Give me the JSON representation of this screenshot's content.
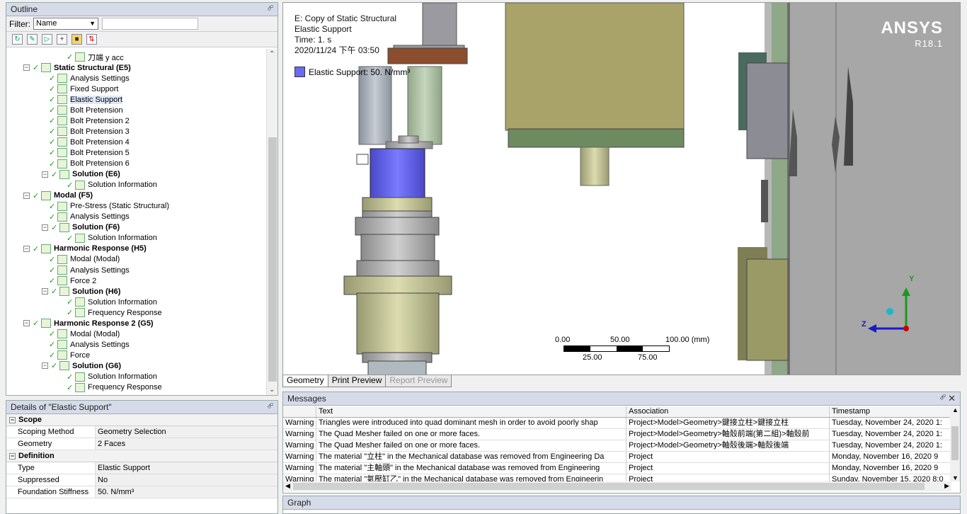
{
  "outline": {
    "title": "Outline",
    "pin": "⬇",
    "filter_label": "Filter:",
    "filter_value": "Name",
    "tree": [
      {
        "label": "刀端 y acc",
        "level": 4,
        "bold": false
      },
      {
        "label": "Static Structural (E5)",
        "level": 2,
        "bold": true,
        "expand": "−"
      },
      {
        "label": "Analysis Settings",
        "level": 3,
        "bold": false
      },
      {
        "label": "Fixed Support",
        "level": 3,
        "bold": false
      },
      {
        "label": "Elastic Support",
        "level": 3,
        "bold": false,
        "selected": true
      },
      {
        "label": "Bolt Pretension",
        "level": 3,
        "bold": false
      },
      {
        "label": "Bolt Pretension 2",
        "level": 3,
        "bold": false
      },
      {
        "label": "Bolt Pretension 3",
        "level": 3,
        "bold": false
      },
      {
        "label": "Bolt Pretension 4",
        "level": 3,
        "bold": false
      },
      {
        "label": "Bolt Pretension 5",
        "level": 3,
        "bold": false
      },
      {
        "label": "Bolt Pretension 6",
        "level": 3,
        "bold": false
      },
      {
        "label": "Solution (E6)",
        "level": 3,
        "bold": true,
        "expand": "−"
      },
      {
        "label": "Solution Information",
        "level": 4,
        "bold": false
      },
      {
        "label": "Modal (F5)",
        "level": 2,
        "bold": true,
        "expand": "−"
      },
      {
        "label": "Pre-Stress (Static Structural)",
        "level": 3,
        "bold": false
      },
      {
        "label": "Analysis Settings",
        "level": 3,
        "bold": false
      },
      {
        "label": "Solution (F6)",
        "level": 3,
        "bold": true,
        "expand": "−"
      },
      {
        "label": "Solution Information",
        "level": 4,
        "bold": false
      },
      {
        "label": "Harmonic Response (H5)",
        "level": 2,
        "bold": true,
        "expand": "−"
      },
      {
        "label": "Modal (Modal)",
        "level": 3,
        "bold": false
      },
      {
        "label": "Analysis Settings",
        "level": 3,
        "bold": false
      },
      {
        "label": "Force 2",
        "level": 3,
        "bold": false
      },
      {
        "label": "Solution (H6)",
        "level": 3,
        "bold": true,
        "expand": "−"
      },
      {
        "label": "Solution Information",
        "level": 4,
        "bold": false
      },
      {
        "label": "Frequency Response",
        "level": 4,
        "bold": false
      },
      {
        "label": "Harmonic Response 2 (G5)",
        "level": 2,
        "bold": true,
        "expand": "−"
      },
      {
        "label": "Modal (Modal)",
        "level": 3,
        "bold": false
      },
      {
        "label": "Analysis Settings",
        "level": 3,
        "bold": false
      },
      {
        "label": "Force",
        "level": 3,
        "bold": false
      },
      {
        "label": "Solution (G6)",
        "level": 3,
        "bold": true,
        "expand": "−"
      },
      {
        "label": "Solution Information",
        "level": 4,
        "bold": false
      },
      {
        "label": "Frequency Response",
        "level": 4,
        "bold": false
      }
    ]
  },
  "details": {
    "title": "Details of \"Elastic Support\"",
    "groups": [
      {
        "name": "Scope",
        "rows": [
          [
            "Scoping Method",
            "Geometry Selection"
          ],
          [
            "Geometry",
            "2 Faces"
          ]
        ]
      },
      {
        "name": "Definition",
        "rows": [
          [
            "Type",
            "Elastic Support"
          ],
          [
            "Suppressed",
            "No"
          ],
          [
            "Foundation Stiffness",
            "50. N/mm³"
          ]
        ]
      }
    ]
  },
  "viewport": {
    "info_lines": [
      "E: Copy of Static Structural",
      "Elastic Support",
      "Time: 1. s",
      "2020/11/24 下午 03:50"
    ],
    "legend": "Elastic Support: 50. N/mm³",
    "legend_color": "#6a6af0",
    "logo": "ANSYS",
    "version": "R18.1",
    "scale_top": [
      "0.00",
      "50.00",
      "100.00 (mm)"
    ],
    "scale_bottom": [
      "25.00",
      "75.00"
    ],
    "axes": {
      "y": "Y",
      "z": "Z"
    }
  },
  "tabs": [
    "Geometry",
    "Print Preview",
    "Report Preview"
  ],
  "messages": {
    "title": "Messages",
    "columns": [
      "Text",
      "Association",
      "Timestamp"
    ],
    "rows": [
      [
        "Warning",
        "Triangles were introduced into quad dominant mesh in order to avoid poorly shap",
        "Project>Model>Geometry>鍵接立柱>鍵接立柱",
        "Tuesday, November 24, 2020 1:"
      ],
      [
        "Warning",
        "The Quad Mesher failed on one or more faces.",
        "Project>Model>Geometry>軸殼前端(第二組)>軸殼前",
        "Tuesday, November 24, 2020 1:"
      ],
      [
        "Warning",
        "The Quad Mesher failed on one or more faces.",
        "Project>Model>Geometry>軸殼後端>軸殼後端",
        "Tuesday, November 24, 2020 1:"
      ],
      [
        "Warning",
        "The material \"立柱\" in the Mechanical database was removed from Engineering Da",
        "Project",
        "Monday, November 16, 2020 9"
      ],
      [
        "Warning",
        "The material \"主軸頭\" in the Mechanical database was removed from Engineering",
        "Project",
        "Monday, November 16, 2020 9"
      ],
      [
        "Warning",
        "The material \"氣壓缸乙\" in the Mechanical database was removed from Engineerin",
        "Project",
        "Sunday, November 15, 2020 8:0"
      ]
    ]
  },
  "graph": {
    "title": "Graph"
  }
}
